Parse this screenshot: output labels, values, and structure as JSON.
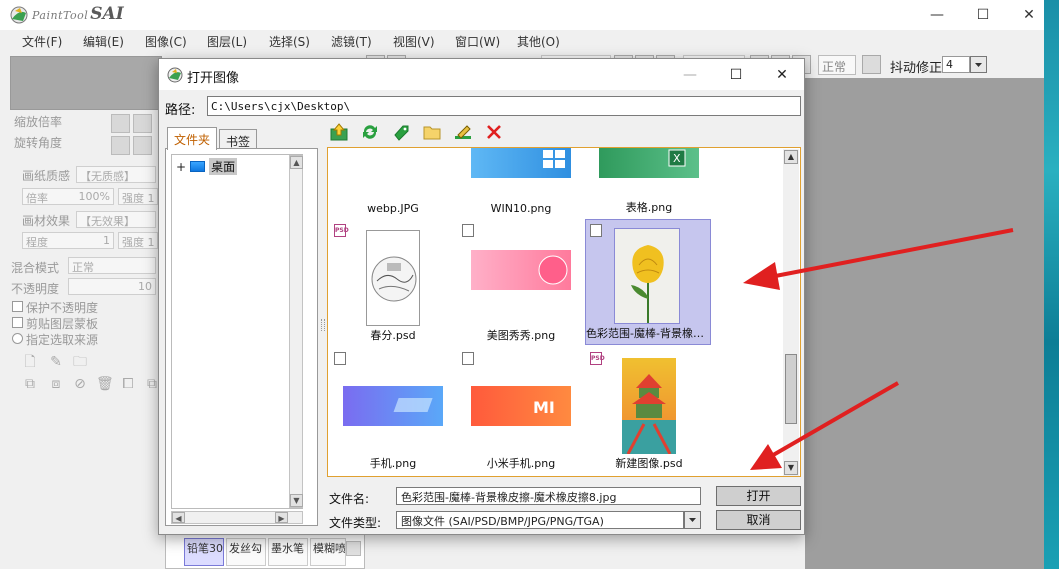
{
  "app": {
    "logo_text": "PaintTool",
    "logo_sai": "SAI",
    "controls": {
      "minimize": "—",
      "maximize": "☐",
      "close": "✕"
    }
  },
  "menu": [
    "文件(F)",
    "编辑(E)",
    "图像(C)",
    "图层(L)",
    "选择(S)",
    "滤镜(T)",
    "视图(V)",
    "窗口(W)",
    "其他(O)"
  ],
  "toolbar": {
    "mode": "正常",
    "stabilizer_label": "抖动修正",
    "stabilizer_value": "4"
  },
  "left_panel": {
    "zoom": "缩放倍率",
    "rotate": "旋转角度",
    "paper_texture": "画纸质感",
    "paper_texture_val": "【无质感】",
    "scale": "倍率",
    "scale_val": "100%",
    "strength": "强度",
    "strength_val": "1",
    "canvas_effect": "画材效果",
    "canvas_effect_val": "【无效果】",
    "degree": "程度",
    "degree_val": "1",
    "strength2": "强度",
    "strength2_val": "1",
    "blend_mode": "混合模式",
    "blend_mode_val": "正常",
    "opacity": "不透明度",
    "opacity_val": "10",
    "preserve_opacity": "保护不透明度",
    "clip_layer": "剪贴图层蒙板",
    "select_source": "指定选取来源"
  },
  "brushes": [
    {
      "label": "铅笔30"
    },
    {
      "label": "发丝勾"
    },
    {
      "label": "墨水笔"
    },
    {
      "label": "模糊喷"
    }
  ],
  "dialog": {
    "title": "打开图像",
    "path_label": "路径:",
    "path_value": "C:\\Users\\cjx\\Desktop\\",
    "tabs": {
      "folders": "文件夹",
      "bookmarks": "书签"
    },
    "tree": {
      "expand": "+",
      "node": "桌面"
    },
    "files": [
      {
        "name": "webp.JPG",
        "type": ""
      },
      {
        "name": "WIN10.png",
        "type": ""
      },
      {
        "name": "表格.png",
        "type": ""
      },
      {
        "name": "春分.psd",
        "type": "PSD"
      },
      {
        "name": "美图秀秀.png",
        "type": ""
      },
      {
        "name": "色彩范围-魔棒-背景橡皮擦-魔术橡皮擦8.jpg",
        "type": ""
      },
      {
        "name": "手机.png",
        "type": ""
      },
      {
        "name": "小米手机.png",
        "type": ""
      },
      {
        "name": "新建图像.psd",
        "type": "PSD"
      }
    ],
    "filename_label": "文件名:",
    "filename_value": "色彩范围-魔棒-背景橡皮擦-魔术橡皮擦8.jpg",
    "filetype_label": "文件类型:",
    "filetype_value": "图像文件 (SAI/PSD/BMP/JPG/PNG/TGA)",
    "open_button": "打开",
    "cancel_button": "取消",
    "mi_logo": "MI"
  },
  "colors": {
    "accent_tab": "#c06000",
    "selection": "#c6c6ee",
    "arrow": "#e02020"
  }
}
